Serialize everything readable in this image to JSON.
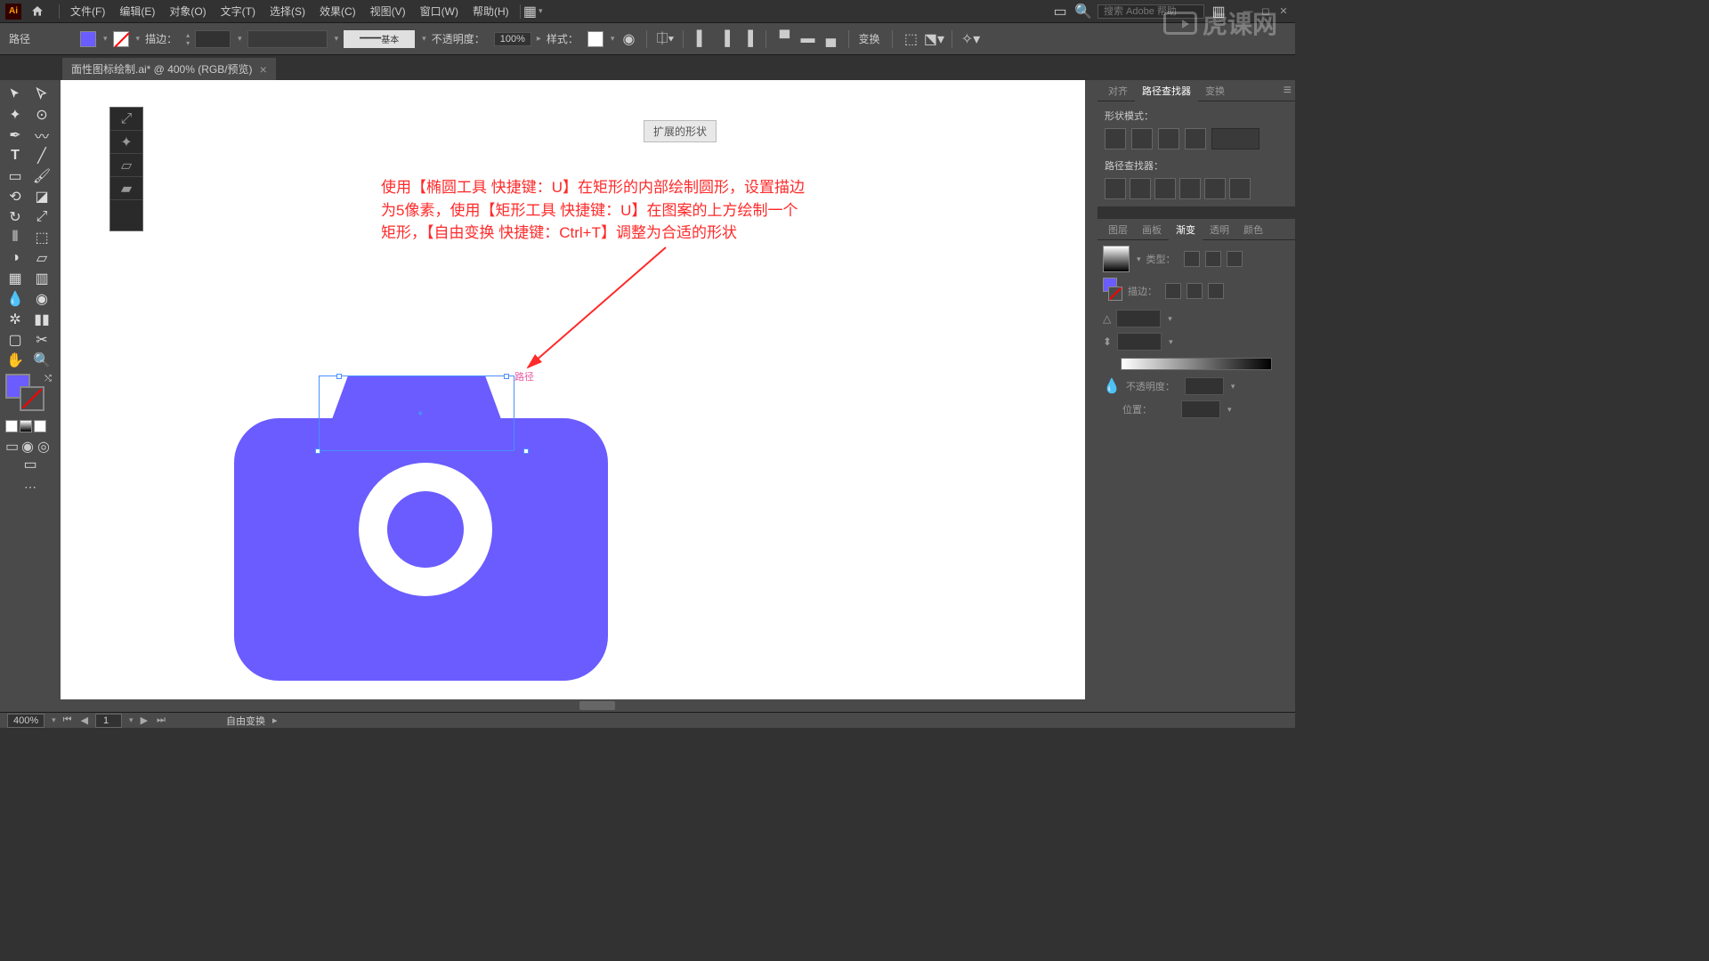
{
  "menubar": {
    "logo": "Ai",
    "items": [
      "文件(F)",
      "编辑(E)",
      "对象(O)",
      "文字(T)",
      "选择(S)",
      "效果(C)",
      "视图(V)",
      "窗口(W)",
      "帮助(H)"
    ],
    "search_placeholder": "搜索 Adobe 帮助"
  },
  "controlbar": {
    "selection_label": "路径",
    "stroke_label": "描边：",
    "stroke_profile": "基本",
    "opacity_label": "不透明度：",
    "opacity_value": "100%",
    "style_label": "样式：",
    "transform_label": "变换"
  },
  "tab": {
    "title": "面性图标绘制.ai* @ 400% (RGB/预览)",
    "close": "×"
  },
  "canvas": {
    "badge": "扩展的形状",
    "instruction_line1": "使用【椭圆工具 快捷键：U】在矩形的内部绘制圆形，设置描边",
    "instruction_line2": "为5像素，使用【矩形工具 快捷键：U】在图案的上方绘制一个",
    "instruction_line3": "矩形，【自由变换 快捷键：Ctrl+T】调整为合适的形状",
    "selection_label": "路径"
  },
  "rightpanel": {
    "align_tabs": [
      "对齐",
      "路径查找器",
      "变换"
    ],
    "align_active": 1,
    "shape_mode_label": "形状模式：",
    "pathfinder_label": "路径查找器：",
    "gradient_tabs": [
      "图层",
      "画板",
      "渐变",
      "透明",
      "颜色"
    ],
    "gradient_active": 2,
    "grad_type_label": "类型：",
    "grad_stroke_label": "描边：",
    "grad_opacity_label": "不透明度：",
    "grad_position_label": "位置："
  },
  "statusbar": {
    "zoom": "400%",
    "artboard": "1",
    "status": "自由变换"
  },
  "watermark": "虎课网",
  "colors": {
    "camera": "#6a5cff",
    "instruction": "#ff2a2a"
  }
}
